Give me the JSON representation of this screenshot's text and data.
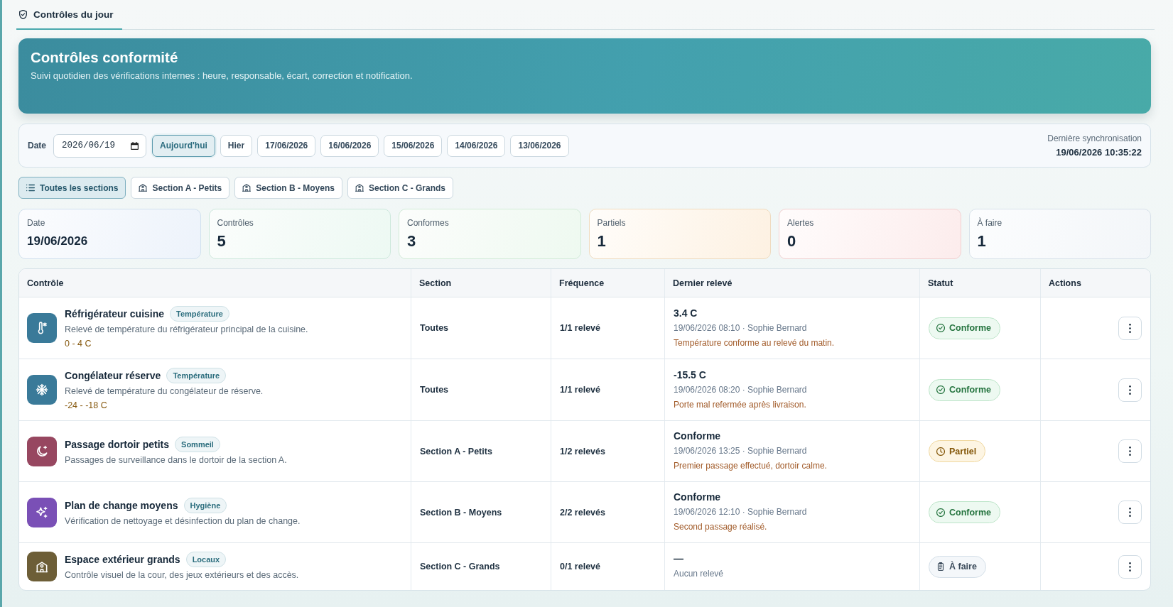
{
  "tabs": [
    {
      "label": "Contrôles du jour",
      "selected": true
    }
  ],
  "header": {
    "title": "Contrôles conformité",
    "subtitle": "Suivi quotidien des vérifications internes : heure, responsable, écart, correction et notification."
  },
  "date_bar": {
    "label": "Date",
    "date_value": "2026/06/19",
    "quick_dates": [
      {
        "label": "Aujourd'hui",
        "selected": true
      },
      {
        "label": "Hier",
        "selected": false
      },
      {
        "label": "17/06/2026",
        "selected": false
      },
      {
        "label": "16/06/2026",
        "selected": false
      },
      {
        "label": "15/06/2026",
        "selected": false
      },
      {
        "label": "14/06/2026",
        "selected": false
      },
      {
        "label": "13/06/2026",
        "selected": false
      }
    ],
    "sync_label": "Dernière synchronisation",
    "sync_value": "19/06/2026 10:35:22"
  },
  "section_filters": [
    {
      "label": "Toutes les sections",
      "kind": "all",
      "selected": true
    },
    {
      "label": "Section A - Petits",
      "kind": "section",
      "selected": false
    },
    {
      "label": "Section B - Moyens",
      "kind": "section",
      "selected": false
    },
    {
      "label": "Section C - Grands",
      "kind": "section",
      "selected": false
    }
  ],
  "stats": [
    {
      "label": "Date",
      "value": "19/06/2026",
      "kind": "date"
    },
    {
      "label": "Contrôles",
      "value": "5",
      "kind": "total"
    },
    {
      "label": "Conformes",
      "value": "3",
      "kind": "ok"
    },
    {
      "label": "Partiels",
      "value": "1",
      "kind": "partial"
    },
    {
      "label": "Alertes",
      "value": "0",
      "kind": "alert"
    },
    {
      "label": "À faire",
      "value": "1",
      "kind": "todo"
    }
  ],
  "table": {
    "columns": [
      "Contrôle",
      "Section",
      "Fréquence",
      "Dernier relevé",
      "Statut",
      "Actions"
    ],
    "rows": [
      {
        "kind": "fridge",
        "name": "Réfrigérateur cuisine",
        "category": "Température",
        "description": "Relevé de température du réfrigérateur principal de la cuisine.",
        "range": "0 - 4 C",
        "section": "Toutes",
        "frequency": "1/1 relevé",
        "last_value": "3.4 C",
        "last_meta": "19/06/2026 08:10 · Sophie Bernard",
        "last_note": "Température conforme au relevé du matin.",
        "status": {
          "kind": "ok",
          "label": "Conforme"
        }
      },
      {
        "kind": "freezer",
        "name": "Congélateur réserve",
        "category": "Température",
        "description": "Relevé de température du congélateur de réserve.",
        "range": "-24 - -18 C",
        "section": "Toutes",
        "frequency": "1/1 relevé",
        "last_value": "-15.5 C",
        "last_meta": "19/06/2026 08:20 · Sophie Bernard",
        "last_note": "Porte mal refermée après livraison.",
        "status": {
          "kind": "ok",
          "label": "Conforme"
        }
      },
      {
        "kind": "sleep",
        "name": "Passage dortoir petits",
        "category": "Sommeil",
        "description": "Passages de surveillance dans le dortoir de la section A.",
        "section": "Section A - Petits",
        "frequency": "1/2 relevés",
        "last_value": "Conforme",
        "last_meta": "19/06/2026 13:25 · Sophie Bernard",
        "last_note": "Premier passage effectué, dortoir calme.",
        "status": {
          "kind": "partial",
          "label": "Partiel"
        }
      },
      {
        "kind": "hygiene",
        "name": "Plan de change moyens",
        "category": "Hygiène",
        "description": "Vérification de nettoyage et désinfection du plan de change.",
        "section": "Section B - Moyens",
        "frequency": "2/2 relevés",
        "last_value": "Conforme",
        "last_meta": "19/06/2026 12:10 · Sophie Bernard",
        "last_note": "Second passage réalisé.",
        "status": {
          "kind": "ok",
          "label": "Conforme"
        }
      },
      {
        "kind": "premises",
        "name": "Espace extérieur grands",
        "category": "Locaux",
        "description": "Contrôle visuel de la cour, des jeux extérieurs et des accès.",
        "section": "Section C - Grands",
        "frequency": "0/1 relevé",
        "last_value": "—",
        "last_meta": "Aucun relevé",
        "status": {
          "kind": "todo",
          "label": "À faire"
        }
      }
    ]
  }
}
